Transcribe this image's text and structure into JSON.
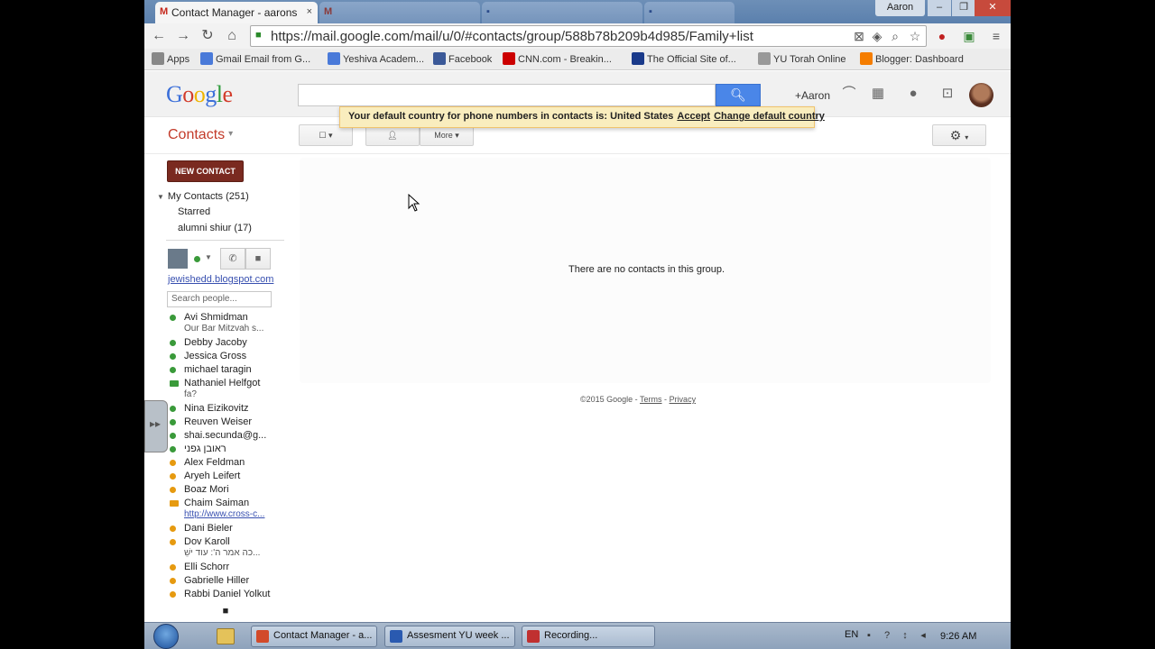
{
  "browser": {
    "tabs": [
      {
        "label": "Contact Manager - aarons",
        "close": "×"
      },
      {
        "label": "",
        "close": ""
      },
      {
        "label": "",
        "close": ""
      },
      {
        "label": "",
        "close": ""
      }
    ],
    "profile_name": "Aaron",
    "window_controls": {
      "minimize": "–",
      "maximize": "❐",
      "close": "✕"
    },
    "url": "https://mail.google.com/mail/u/0/#contacts/group/588b78b209b4d985/Family+list",
    "bookmarks": [
      {
        "label": "Apps",
        "icon_color": "#888888"
      },
      {
        "label": "Gmail Email from G...",
        "icon_color": "#4a7ad9"
      },
      {
        "label": "Yeshiva Academ...",
        "icon_color": "#4a7ad9"
      },
      {
        "label": "Facebook",
        "icon_color": "#3b5998"
      },
      {
        "label": "CNN.com - Breakin...",
        "icon_color": "#cc0000"
      },
      {
        "label": "The Official Site of...",
        "icon_color": "#1a3a8a"
      },
      {
        "label": "YU Torah Online",
        "icon_color": "#999999"
      },
      {
        "label": "Blogger: Dashboard",
        "icon_color": "#f57d00"
      }
    ]
  },
  "google_header": {
    "logo": {
      "g1": "G",
      "o1": "o",
      "o2": "o",
      "g2": "g",
      "l": "l",
      "e": "e"
    },
    "search_placeholder": "",
    "search_icon": "search-icon",
    "plus_name": "+Aaron"
  },
  "notice": {
    "text": "Your default country for phone numbers in contacts is: United States",
    "accept": "Accept",
    "change": "Change default country"
  },
  "contacts_bar": {
    "title": "Contacts",
    "caret": "▾",
    "select_caret": "▾",
    "more_label": "More ▾",
    "settings_caret": "▾"
  },
  "sidebar": {
    "new_contact": "NEW CONTACT",
    "my_contacts": "My Contacts (251)",
    "groups": [
      "Starred",
      "alumni shiur (17)"
    ]
  },
  "chat": {
    "link": "jewishedd.blogspot.com",
    "search_placeholder": "Search people...",
    "buddies": [
      {
        "name": "Avi Shmidman",
        "sub": "Our Bar Mitzvah s...",
        "status": "green"
      },
      {
        "name": "Debby Jacoby",
        "sub": "",
        "status": "green"
      },
      {
        "name": "Jessica Gross",
        "sub": "",
        "status": "green"
      },
      {
        "name": "michael taragin",
        "sub": "",
        "status": "green"
      },
      {
        "name": "Nathaniel Helfgot",
        "sub": "fa?",
        "status": "video"
      },
      {
        "name": "Nina Eizikovitz",
        "sub": "",
        "status": "green"
      },
      {
        "name": "Reuven Weiser",
        "sub": "",
        "status": "green"
      },
      {
        "name": "shai.secunda@g...",
        "sub": "",
        "status": "green"
      },
      {
        "name": "ראובן גפני",
        "sub": "",
        "status": "green"
      },
      {
        "name": "Alex Feldman",
        "sub": "",
        "status": "orange"
      },
      {
        "name": "Aryeh Leifert",
        "sub": "",
        "status": "orange"
      },
      {
        "name": "Boaz Mori",
        "sub": "",
        "status": "orange"
      },
      {
        "name": "Chaim Saiman",
        "sub": "http://www.cross-c...",
        "status": "video-orange"
      },
      {
        "name": "Dani Bieler",
        "sub": "",
        "status": "orange"
      },
      {
        "name": "Dov Karoll",
        "sub": "כה אמר ה': עוד ישֵׁ...",
        "status": "orange"
      },
      {
        "name": "Elli Schorr",
        "sub": "",
        "status": "orange"
      },
      {
        "name": "Gabrielle Hiller",
        "sub": "",
        "status": "orange"
      },
      {
        "name": "Rabbi Daniel Yolkut",
        "sub": "",
        "status": "orange"
      }
    ]
  },
  "main": {
    "empty_message": "There are no contacts in this group.",
    "footer_copyright": "©2015 Google -",
    "footer_terms": "Terms",
    "footer_sep": "-",
    "footer_privacy": "Privacy"
  },
  "taskbar": {
    "tasks": [
      {
        "label": "Contact Manager - a...",
        "icon_color": "#d24a2a"
      },
      {
        "label": "Assesment YU week ...",
        "icon_color": "#2a5ab0"
      },
      {
        "label": "Recording...",
        "icon_color": "#c03030"
      }
    ],
    "lang": "EN",
    "time": "9:26 AM"
  }
}
